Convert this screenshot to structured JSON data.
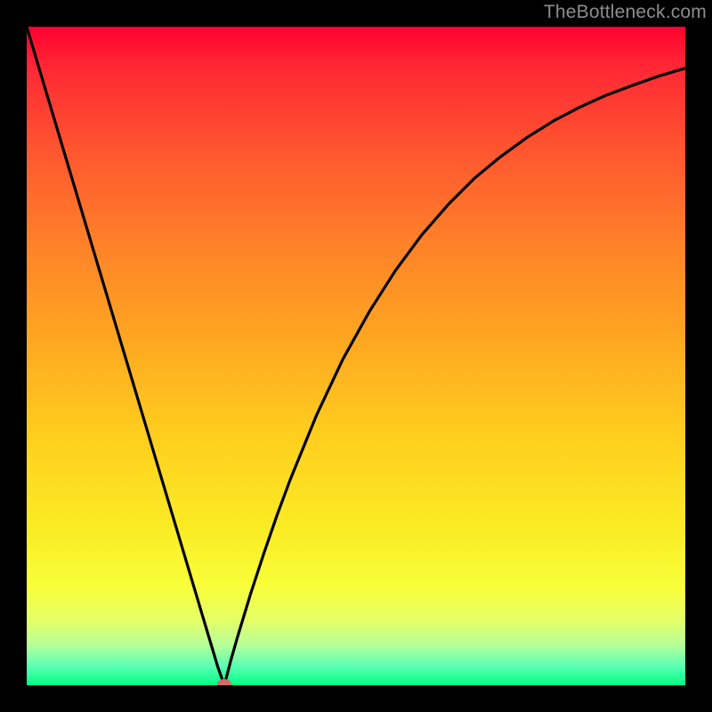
{
  "watermark": {
    "text": "TheBottleneck.com"
  },
  "chart_data": {
    "type": "line",
    "title": "",
    "xlabel": "",
    "ylabel": "",
    "xlim": [
      0,
      100
    ],
    "ylim": [
      0,
      100
    ],
    "grid": false,
    "series": [
      {
        "name": "curve",
        "x": [
          0,
          2,
          4,
          6,
          8,
          10,
          12,
          14,
          16,
          18,
          20,
          22,
          24,
          26,
          28,
          29,
          30,
          31,
          32,
          34,
          36,
          38,
          40,
          44,
          48,
          52,
          56,
          60,
          64,
          68,
          72,
          76,
          80,
          84,
          88,
          92,
          96,
          100
        ],
        "y": [
          100,
          93.3,
          86.6,
          79.9,
          73.2,
          66.5,
          59.8,
          53.1,
          46.4,
          39.7,
          33.0,
          26.3,
          19.6,
          12.9,
          6.2,
          2.85,
          0,
          3.8,
          7.3,
          13.9,
          20.0,
          25.8,
          31.2,
          41.0,
          49.5,
          56.7,
          63.0,
          68.4,
          73.0,
          77.0,
          80.3,
          83.2,
          85.7,
          87.8,
          89.6,
          91.1,
          92.5,
          93.7
        ]
      }
    ],
    "marker": {
      "x": 30,
      "y": 0.2,
      "color": "#d56a6a"
    }
  },
  "colors": {
    "curve": "#000000",
    "marker": "#d56a6a",
    "frame": "#000000"
  }
}
